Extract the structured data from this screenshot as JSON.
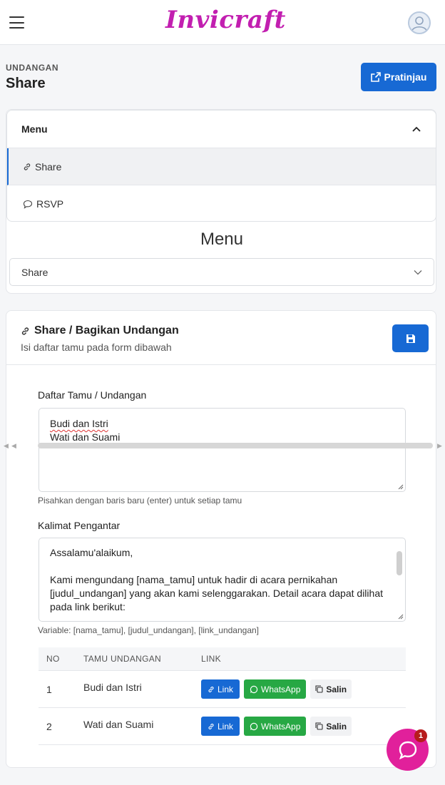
{
  "header": {
    "logo": "Invicraft"
  },
  "page": {
    "eyebrow": "UNDANGAN",
    "title": "Share",
    "preview_button": "Pratinjau"
  },
  "menu": {
    "heading": "Menu",
    "items": [
      {
        "label": "Share",
        "icon": "link-icon",
        "active": true
      },
      {
        "label": "RSVP",
        "icon": "chat-icon",
        "active": false
      }
    ],
    "mobile_title": "Menu",
    "select_value": "Share"
  },
  "share": {
    "title": "Share / Bagikan Undangan",
    "subtitle": "Isi daftar tamu pada form dibawah",
    "guest_label": "Daftar Tamu / Undangan",
    "guest_lines": [
      "Budi dan Istri",
      "Wati dan Suami"
    ],
    "guest_hint": "Pisahkan dengan baris baru (enter) untuk setiap tamu",
    "intro_label": "Kalimat Pengantar",
    "intro_lines": [
      "Assalamu'alaikum,",
      "",
      "Kami mengundang [nama_tamu] untuk hadir di acara pernikahan",
      "[judul_undangan] yang akan kami selenggarakan. Detail acara dapat dilihat",
      "pada link berikut:"
    ],
    "intro_hint": "Variable: [nama_tamu], [judul_undangan], [link_undangan]"
  },
  "table": {
    "headers": [
      "NO",
      "TAMU UNDANGAN",
      "LINK"
    ],
    "rows": [
      {
        "no": "1",
        "name": "Budi dan Istri"
      },
      {
        "no": "2",
        "name": "Wati dan Suami"
      }
    ],
    "buttons": {
      "link": "Link",
      "whatsapp": "WhatsApp",
      "copy": "Salin"
    }
  },
  "chat": {
    "badge": "1"
  },
  "colors": {
    "primary": "#1769d4",
    "brand": "#c21fb0",
    "whatsapp": "#27a844",
    "chat": "#e1209b"
  }
}
